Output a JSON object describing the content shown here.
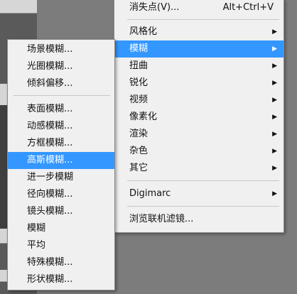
{
  "filter_menu": {
    "items": [
      {
        "label": "消失点(V)...",
        "shortcut": "Alt+Ctrl+V"
      },
      {
        "label": "风格化"
      },
      {
        "label": "模糊"
      },
      {
        "label": "扭曲"
      },
      {
        "label": "锐化"
      },
      {
        "label": "视频"
      },
      {
        "label": "像素化"
      },
      {
        "label": "渲染"
      },
      {
        "label": "杂色"
      },
      {
        "label": "其它"
      },
      {
        "label": "Digimarc"
      },
      {
        "label": "浏览联机滤镜..."
      }
    ],
    "active_item": "模糊",
    "submenu_arrow_icon": "triangle-right-icon"
  },
  "blur_submenu": {
    "items": [
      {
        "label": "场景模糊..."
      },
      {
        "label": "光圈模糊..."
      },
      {
        "label": "倾斜偏移..."
      },
      {
        "label": "表面模糊..."
      },
      {
        "label": "动感模糊..."
      },
      {
        "label": "方框模糊..."
      },
      {
        "label": "高斯模糊..."
      },
      {
        "label": "进一步模糊"
      },
      {
        "label": "径向模糊..."
      },
      {
        "label": "镜头模糊..."
      },
      {
        "label": "模糊"
      },
      {
        "label": "平均"
      },
      {
        "label": "特殊模糊..."
      },
      {
        "label": "形状模糊..."
      }
    ],
    "active_item": "高斯模糊..."
  },
  "colors": {
    "menu_background": "#f0f0f0",
    "highlight": "#3397ff",
    "highlight_text": "#ffffff"
  }
}
